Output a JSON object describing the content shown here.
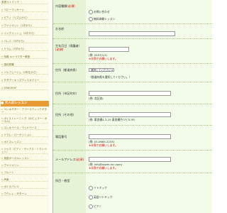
{
  "sidebar": {
    "items_top": [
      {
        "label": "英語リトミック",
        "bullet": ""
      },
      {
        "label": "» ベビーマッサージ",
        "bullet": "»"
      },
      {
        "label": "» ピアノ（リズムから）",
        "bullet": "»"
      },
      {
        "label": "» ヴァイオリン（3才から）",
        "bullet": "»"
      },
      {
        "label": "» イングリッシュ（3才から）",
        "bullet": "»"
      },
      {
        "label": "» バレエ（3才から）",
        "bullet": "»"
      },
      {
        "label": "» ドラム（3才から）",
        "bullet": "»"
      },
      {
        "label": "» 特撮 キャラクター教室",
        "bullet": "»"
      },
      {
        "label": "» 高校受験",
        "bullet": "»"
      },
      {
        "label": "» ソルフェージュ（1年生から）",
        "bullet": "»"
      },
      {
        "label": "» サタデーキッズディスカバリー",
        "bullet": "»"
      },
      {
        "label": "» SSWSHOP",
        "bullet": "»"
      }
    ],
    "section_header": "大人のレッスン",
    "items_bottom": [
      {
        "label": "» エレキギター・アコースティックギター"
      },
      {
        "label": "» ボイストレーニング（ポピュラー・ボーカル）"
      },
      {
        "label": "» エレキベース・ウッドベース"
      },
      {
        "label": "» ドラム・パーカッション"
      },
      {
        "label": "» ボイスレッスン"
      },
      {
        "label": "» ジャズ（ピアノ・サックス・トランペット）"
      },
      {
        "label": "» 英語ボーカルレッスン"
      },
      {
        "label": "» ヴァイオリン"
      },
      {
        "label": "» フルート"
      },
      {
        "label": "» 声楽"
      },
      {
        "label": "» ボイスバレエ"
      },
      {
        "label": "» ウクレレ・ギターレ"
      }
    ]
  },
  "form": {
    "inquiry": {
      "label": "内容種類",
      "req": "(必須)",
      "options": [
        "お問い合わせ",
        "無料体験レッスン"
      ]
    },
    "name": {
      "label": "お名前"
    },
    "birthdate": {
      "label": "生年月日（保護者）",
      "req": "(必須)",
      "example": "(例: 2007/1/1)",
      "note": "※半角でお願いします。"
    },
    "address1": {
      "label": "住所（都道府県）",
      "select_value": "選択してください",
      "note": "（都道府県を選択してください。）"
    },
    "address2": {
      "label": "住所（市区町村）",
      "example": "(例: 北区浪)"
    },
    "address3": {
      "label": "住所（その他）",
      "example": "(例: 東浪横4-3-15 東浪横丹ジヒル3F)"
    },
    "phone": {
      "label": "電話番号",
      "example": "(例: 03-0665-2233)",
      "note": "※半角でお願いします。"
    },
    "email": {
      "label": "メールアドレス",
      "req": "(必須)",
      "example": "(例: info@sswm-inc.com)",
      "note": "※半角でお願いします。"
    },
    "course": {
      "label": "科目・教室",
      "options": [
        "リトミック",
        "英語リトミック",
        "ピアノ"
      ]
    }
  }
}
